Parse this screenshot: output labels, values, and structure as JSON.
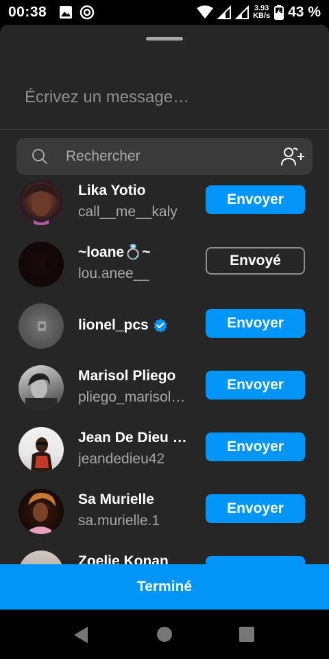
{
  "status_bar": {
    "time": "00:38",
    "net_speed_value": "3.93",
    "net_speed_unit": "KB/s",
    "battery": "43 %"
  },
  "sheet": {
    "message_placeholder": "Écrivez un message…",
    "search_placeholder": "Rechercher",
    "done_label": "Terminé"
  },
  "contacts": [
    {
      "name": "Lika Yotio",
      "username": "call__me__kaly",
      "action": "Envoyer",
      "verified": false
    },
    {
      "name": "~loane💍~",
      "username": "lou.anee__",
      "action": "Envoyé",
      "verified": false
    },
    {
      "name": "lionel_pcs",
      "username": "",
      "action": "Envoyer",
      "verified": true
    },
    {
      "name": "Marisol Pliego",
      "username": "pliego_marisol…",
      "action": "Envoyer",
      "verified": false
    },
    {
      "name": "Jean De Dieu …",
      "username": "jeandedieu42",
      "action": "Envoyer",
      "verified": false
    },
    {
      "name": "Sa Murielle",
      "username": "sa.murielle.1",
      "action": "Envoyer",
      "verified": false
    },
    {
      "name": "Zoelie Konan",
      "username": "",
      "action": "Envoyer",
      "verified": false
    }
  ],
  "colors": {
    "accent": "#0095f6",
    "sheet_bg": "#262626",
    "search_bg": "#3a3a3a",
    "secondary_text": "#a8a8a8"
  },
  "icons": [
    "image-icon",
    "at-sign-icon",
    "wifi-icon",
    "signal-icon",
    "battery-charging-icon",
    "search-icon",
    "add-people-icon",
    "verified-badge-icon",
    "back-icon",
    "home-icon",
    "recents-icon"
  ]
}
